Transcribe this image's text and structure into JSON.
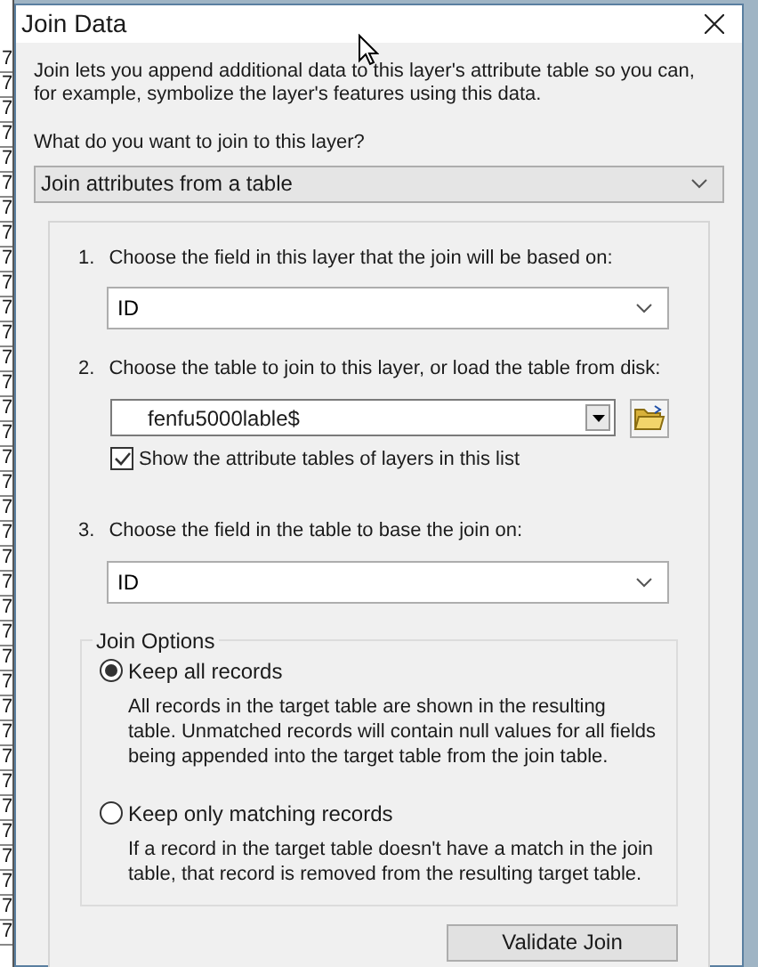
{
  "background_column": [
    "7",
    "7",
    "7",
    "7",
    "7",
    "7",
    "7",
    "7",
    "7",
    "7",
    "7",
    "7",
    "7",
    "7",
    "7",
    "7",
    "7",
    "7",
    "7",
    "7",
    "7",
    "7",
    "7",
    "7",
    "7",
    "7",
    "7",
    "7",
    "7",
    "7",
    "7",
    "7",
    "7",
    "7",
    "7",
    "7"
  ],
  "window": {
    "title": "Join Data"
  },
  "description": "Join lets you append additional data to this layer's attribute table so you can, for example, symbolize the layer's features using this data.",
  "question": "What do you want to join to this layer?",
  "join_type": {
    "value": "Join attributes from a table"
  },
  "steps": [
    {
      "number": "1.",
      "label": "Choose the field in this layer that the join will be based on:",
      "kind": "combo",
      "value": "ID"
    },
    {
      "number": "2.",
      "label": "Choose the table to join to this layer, or load the table from disk:",
      "kind": "table",
      "value": "fenfu5000lable$",
      "checkbox": {
        "label": "Show the attribute tables of layers in this list",
        "checked": true
      }
    },
    {
      "number": "3.",
      "label": "Choose the field in the table to base the join on:",
      "kind": "combo",
      "value": "ID"
    }
  ],
  "join_options": {
    "title": "Join Options",
    "options": [
      {
        "label": "Keep all records",
        "selected": true,
        "description": "All records in the target table are shown in the resulting table. Unmatched records will contain null values for all fields being appended into the target table from the join table."
      },
      {
        "label": "Keep only matching records",
        "selected": false,
        "description": "If a record in the target table doesn't have a match in the join table, that record is removed from the resulting target table."
      }
    ]
  },
  "buttons": [
    "Validate Join"
  ]
}
